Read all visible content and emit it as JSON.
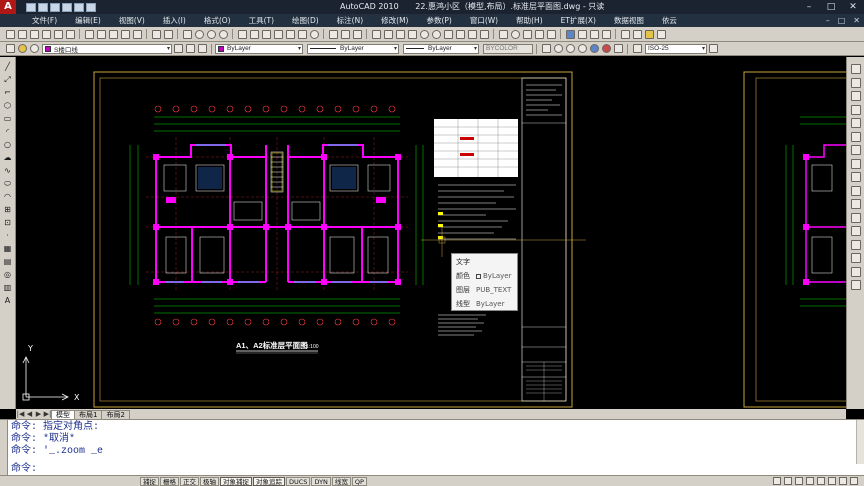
{
  "window": {
    "app_title": "AutoCAD 2010",
    "doc_title": "22.惠鸿小区（模型,布局）.标准层平面图.dwg - 只读",
    "buttons": [
      "–",
      "□",
      "✕"
    ]
  },
  "menu": {
    "items": [
      "文件(F)",
      "编辑(E)",
      "视图(V)",
      "插入(I)",
      "格式(O)",
      "工具(T)",
      "绘图(D)",
      "标注(N)",
      "修改(M)",
      "参数(P)",
      "窗口(W)",
      "帮助(H)",
      "ET扩展(X)",
      "数据视图",
      "依云"
    ],
    "mdi_buttons": [
      "–",
      "□",
      "✕"
    ]
  },
  "toolbar2": {
    "layer": "S楼口线",
    "color": "ByLayer",
    "linetype": "ByLayer",
    "lineweight": "ByLayer",
    "plotstyle": "BYCOLOR",
    "dimstyle": "ISO-25"
  },
  "drawing": {
    "plan_title": "A1、A2标准层平面图",
    "plan_scale": "1:100",
    "ucs_x": "X",
    "ucs_y": "Y"
  },
  "tooltip": {
    "heading": "文字",
    "rows": [
      {
        "key": "颜色",
        "value": "ByLayer"
      },
      {
        "key": "图层",
        "value": "PUB_TEXT"
      },
      {
        "key": "线型",
        "value": "ByLayer"
      }
    ]
  },
  "tabs": {
    "nav": [
      "|◀",
      "◀",
      "▶",
      "▶|"
    ],
    "items": [
      "模型",
      "布局1",
      "布局2"
    ],
    "active": 0
  },
  "command": {
    "history": [
      "命令: 指定对角点:",
      "命令: *取消*",
      "命令: '_.zoom _e"
    ],
    "prompt": "命令:"
  },
  "status": {
    "buttons": [
      "捕捉",
      "栅格",
      "正交",
      "极轴",
      "对象捕捉",
      "对象追踪",
      "DUCS",
      "DYN",
      "线宽",
      "QP"
    ],
    "active": [
      4,
      5
    ]
  },
  "colors": {
    "wall": "#ff00ff",
    "frame": "#c9a33c",
    "grid": "#ff3333",
    "dim": "#00e000",
    "line": "#ffffff",
    "cyan": "#00d0d0",
    "yellow": "#ffff00"
  }
}
